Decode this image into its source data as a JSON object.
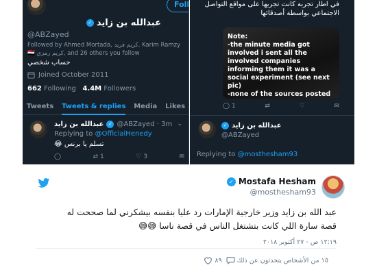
{
  "colors": {
    "dark_bg": "#15202b",
    "accent_blue": "#1da1f2",
    "muted_gray": "#8899a6",
    "light_bg": "#ffffff"
  },
  "profile": {
    "follow_label": "Follow",
    "name": "عبدالله بن زايد",
    "handle": "@ABZayed",
    "followed_by": "Followed by Ahmed Mortada, كريم فريد, Karim Ramzy 🇪🇬 كريم رمزي, and 26 others you follow",
    "bio": "حساب شخصي",
    "joined": "Joined October 2011",
    "following_count": "662",
    "following_label": "Following",
    "followers_count": "4.4M",
    "followers_label": "Followers",
    "tabs": [
      {
        "label": "Tweets"
      },
      {
        "label": "Tweets & replies"
      },
      {
        "label": "Media"
      },
      {
        "label": "Likes"
      }
    ]
  },
  "left_tweet": {
    "name": "عبدالله بن زايد",
    "handle_time": "@ABZayed · 3m",
    "replying_label": "Replying to",
    "replying_handle": "@OfficialHenedy",
    "text": "تسلم يا برنس 😂",
    "reply_count": "",
    "retweet_count": "1",
    "like_count": "3"
  },
  "right_panel": {
    "text": "في اطار تجربة كانت تجريها على مواقع التواصل الاجتماعي بواسطة أصدقائها",
    "media_note": "Note:\n-the minute media got involved i sent all the involved companies informing them it was a social experiment (see next pic)\n-none of the sources posted",
    "reply_count": "1",
    "retweet_count": "",
    "like_count": "",
    "quoted_name": "عبدالله بن زايد",
    "quoted_handle": "@ABZayed",
    "replying_label": "Replying to",
    "replying_handle": "@mosthesham93"
  },
  "main_tweet": {
    "author_name": "Mostafa Hesham",
    "author_handle": "@mosthesham93",
    "body": "عبد الله بن زايد وزير خارجية الإمارات رد عليا بنفسه بيشكرني لما صححت له قصة سارة اللي كانت بتشتغل الناس في قصة ناسا 😅😅",
    "timestamp": "١٢:١٩ ص - ٢٧ أكتوبر ٢٠١٨",
    "like_count": "٨٩",
    "talking_text": "١٥ من الأشخاص يتحدثون عن ذلك"
  }
}
